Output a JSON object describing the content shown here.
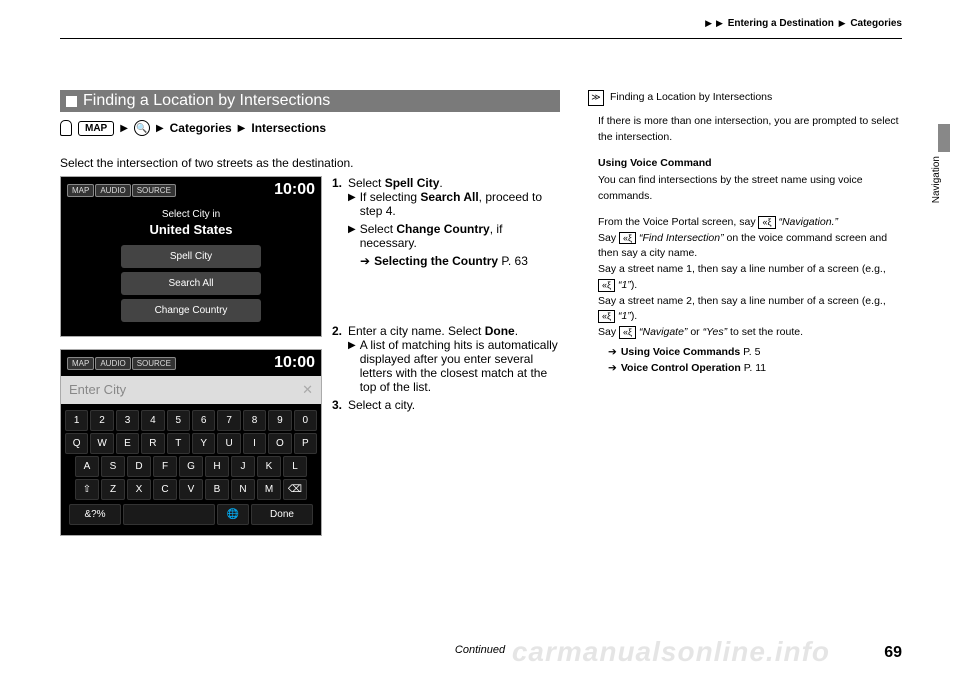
{
  "breadcrumb": {
    "tri": "▶",
    "a": "Entering a Destination",
    "b": "Categories"
  },
  "sideTab": "Navigation",
  "section": {
    "title": "Finding a Location by Intersections"
  },
  "path": {
    "map": "MAP",
    "cat": "Categories",
    "inter": "Intersections"
  },
  "intro": "Select the intersection of two streets as the destination.",
  "shot1": {
    "btn1": "MAP",
    "btn2": "AUDIO",
    "btn3": "SOURCE",
    "time": "10:00",
    "label": "Select City in",
    "country": "United States",
    "m1": "Spell City",
    "m2": "Search All",
    "m3": "Change Country"
  },
  "shot2": {
    "btn1": "MAP",
    "btn2": "AUDIO",
    "btn3": "SOURCE",
    "time": "10:00",
    "placeholder": "Enter City",
    "row1": [
      "1",
      "2",
      "3",
      "4",
      "5",
      "6",
      "7",
      "8",
      "9",
      "0"
    ],
    "row2": [
      "Q",
      "W",
      "E",
      "R",
      "T",
      "Y",
      "U",
      "I",
      "O",
      "P"
    ],
    "row3": [
      "A",
      "S",
      "D",
      "F",
      "G",
      "H",
      "J",
      "K",
      "L"
    ],
    "row4": [
      "⇧",
      "Z",
      "X",
      "C",
      "V",
      "B",
      "N",
      "M",
      "⌫"
    ],
    "sym": "&?%",
    "space": " ",
    "globe": "🌐",
    "done": "Done"
  },
  "steps": {
    "s1a": "Select ",
    "s1b": "Spell City",
    "s1c": ".",
    "s1sub1a": "If selecting ",
    "s1sub1b": "Search All",
    "s1sub1c": ", proceed to step 4.",
    "s1sub2a": "Select ",
    "s1sub2b": "Change Country",
    "s1sub2c": ", if necessary.",
    "ref1a": "Selecting the Country",
    "ref1b": " P. 63",
    "s2a": "Enter a city name. Select ",
    "s2b": "Done",
    "s2c": ".",
    "s2sub": "A list of matching hits is automatically displayed after you enter several letters with the closest match at the top of the list.",
    "s3": "Select a city."
  },
  "right": {
    "title": "Finding a Location by Intersections",
    "p1": "If there is more than one intersection, you are prompted to select the intersection.",
    "h1": "Using Voice Command",
    "p2": "You can find intersections by the street name using voice commands.",
    "p3a": "From the Voice Portal screen, say ",
    "p3b": "“Navigation.”",
    "p4a": "Say ",
    "p4b": "“Find Intersection”",
    "p4c": " on the voice command screen and then say a city name.",
    "p5a": "Say a street name 1, then say a line number of a screen (e.g., ",
    "p5b": "“1”",
    "p5c": ").",
    "p6a": "Say a street name 2, then say a line number of a screen (e.g., ",
    "p6b": "“1”",
    "p6c": ").",
    "p7a": "Say ",
    "p7b": "“Navigate”",
    "p7c": " or ",
    "p7d": "“Yes”",
    "p7e": " to set the route.",
    "ref1a": "Using Voice Commands",
    "ref1b": " P. 5",
    "ref2a": "Voice Control Operation",
    "ref2b": " P. 11",
    "voiceIcon": "«ξ"
  },
  "footer": {
    "continued": "Continued",
    "page": "69",
    "watermark": "carmanualsonline.info"
  }
}
